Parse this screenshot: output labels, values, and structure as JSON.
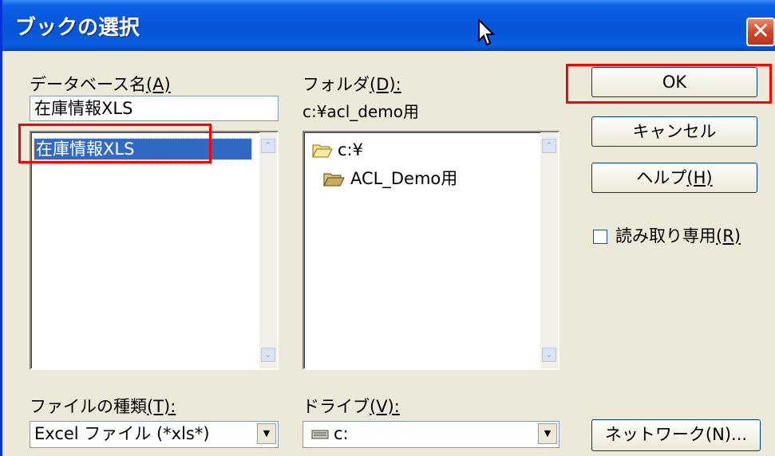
{
  "window": {
    "title": "ブックの選択",
    "close_glyph": "✕"
  },
  "database": {
    "label": "データベース名",
    "label_key": "(A)",
    "value": "在庫情報XLS",
    "list_items": [
      "在庫情報XLS"
    ]
  },
  "folder": {
    "label": "フォルダ",
    "label_key": "(D):",
    "current_path": "c:¥acl_demo用",
    "tree": [
      "c:¥",
      "ACL_Demo用"
    ]
  },
  "buttons": {
    "ok": "OK",
    "cancel": "キャンセル",
    "help": "ヘルプ",
    "help_key": "(H)",
    "network": "ネットワーク(N)..."
  },
  "readonly": {
    "label": "読み取り専用",
    "label_key": "(R)",
    "checked": false
  },
  "file_type": {
    "label": "ファイルの種類",
    "label_key": "(T):",
    "selected": "Excel ファイル (*xls*)"
  },
  "drive": {
    "label": "ドライブ",
    "label_key": "(V):",
    "selected": "c:"
  },
  "scroll_up": "⌃",
  "scroll_down": "⌄",
  "combo_down": "▼",
  "colors": {
    "title_bar": "#0754d6",
    "dialog_bg": "#ece9d8",
    "selection": "#316ac5",
    "highlight_box": "#ff0000"
  }
}
